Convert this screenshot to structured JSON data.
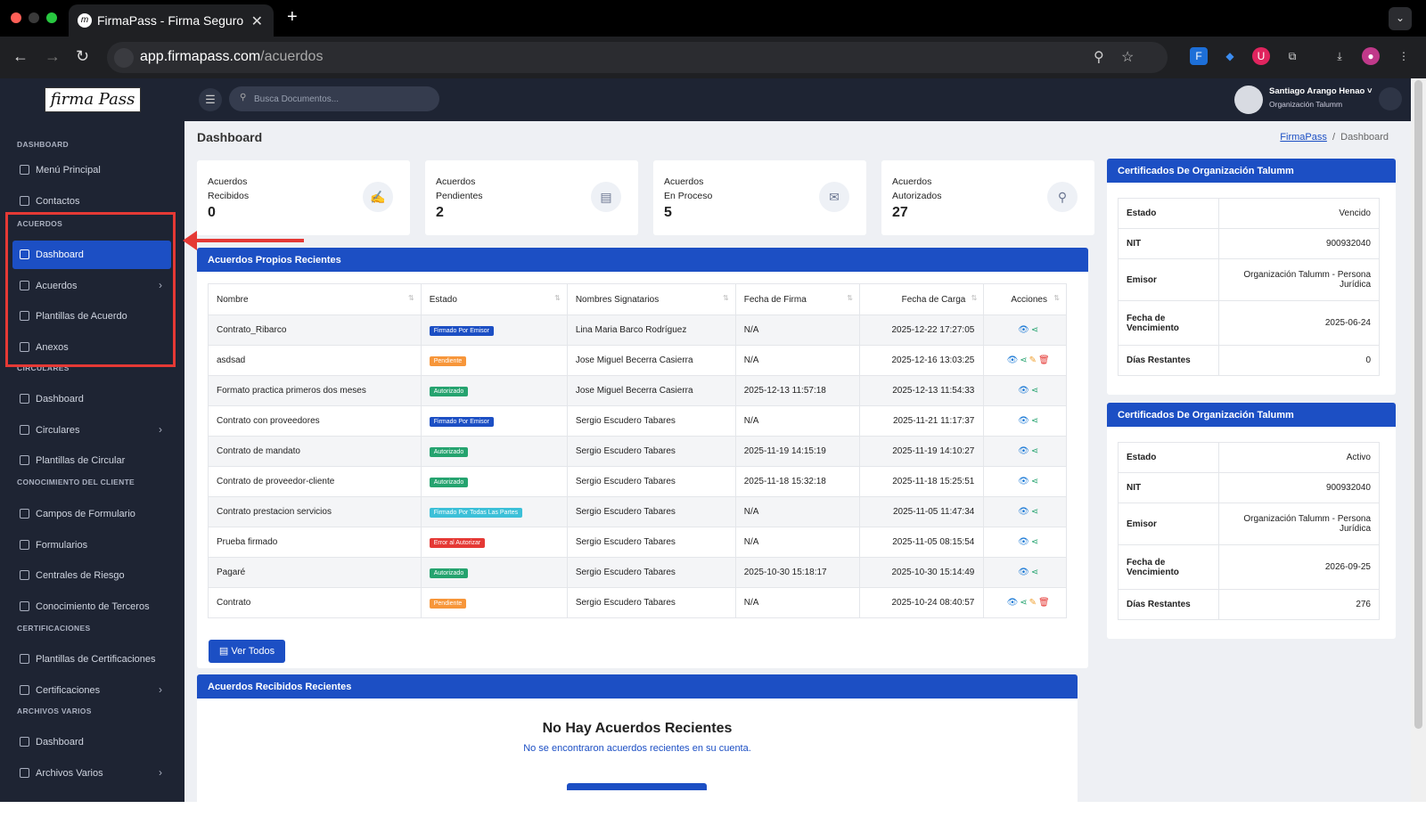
{
  "browser": {
    "tab_title": "FirmaPass - Firma Seguro",
    "url_host": "app.firmapass.com",
    "url_path": "/acuerdos"
  },
  "app": {
    "logo": "firma Pass",
    "search_placeholder": "Busca Documentos...",
    "user_name": "Santiago Arango Henao",
    "user_org": "Organización Talumm"
  },
  "sidebar": {
    "sections": [
      "DASHBOARD",
      "ACUERDOS",
      "CIRCULARES",
      "CONOCIMIENTO DEL CLIENTE",
      "CERTIFICACIONES",
      "ARCHIVOS VARIOS"
    ],
    "items": [
      "Menú Principal",
      "Contactos",
      "Dashboard",
      "Acuerdos",
      "Plantillas de Acuerdo",
      "Anexos",
      "Dashboard",
      "Circulares",
      "Plantillas de Circular",
      "Campos de Formulario",
      "Formularios",
      "Centrales de Riesgo",
      "Conocimiento de Terceros",
      "Plantillas de Certificaciones",
      "Certificaciones",
      "Dashboard",
      "Archivos Varios"
    ]
  },
  "page": {
    "title": "Dashboard",
    "breadcrumb_home": "FirmaPass",
    "breadcrumb_sep": "/",
    "breadcrumb_current": "Dashboard"
  },
  "stats": [
    {
      "l1": "Acuerdos",
      "l2": "Recibidos",
      "value": "0"
    },
    {
      "l1": "Acuerdos",
      "l2": "Pendientes",
      "value": "2"
    },
    {
      "l1": "Acuerdos",
      "l2": "En Proceso",
      "value": "5"
    },
    {
      "l1": "Acuerdos",
      "l2": "Autorizados",
      "value": "27"
    }
  ],
  "recent": {
    "title": "Acuerdos Propios Recientes",
    "columns": [
      "Nombre",
      "Estado",
      "Nombres Signatarios",
      "Fecha de Firma",
      "Fecha de Carga",
      "Acciones"
    ],
    "rows": [
      [
        "Contrato_Ribarco",
        "Firmado Por Emisor",
        "Lina Maria Barco Rodríguez",
        "N/A",
        "2025-12-22 17:27:05"
      ],
      [
        "asdsad",
        "Pendiente",
        "Jose Miguel Becerra Casierra",
        "N/A",
        "2025-12-16 13:03:25"
      ],
      [
        "Formato practica primeros dos meses",
        "Autorizado",
        "Jose Miguel Becerra Casierra",
        "2025-12-13 11:57:18",
        "2025-12-13 11:54:33"
      ],
      [
        "Contrato con proveedores",
        "Firmado Por Emisor",
        "Sergio Escudero Tabares",
        "N/A",
        "2025-11-21 11:17:37"
      ],
      [
        "Contrato de mandato",
        "Autorizado",
        "Sergio Escudero Tabares",
        "2025-11-19 14:15:19",
        "2025-11-19 14:10:27"
      ],
      [
        "Contrato de proveedor-cliente",
        "Autorizado",
        "Sergio Escudero Tabares",
        "2025-11-18 15:32:18",
        "2025-11-18 15:25:51"
      ],
      [
        "Contrato prestacion servicios",
        "Firmado Por Todas Las Partes",
        "Sergio Escudero Tabares",
        "N/A",
        "2025-11-05 11:47:34"
      ],
      [
        "Prueba firmado",
        "Error al Autorizar",
        "Sergio Escudero Tabares",
        "N/A",
        "2025-11-05 08:15:54"
      ],
      [
        "Pagaré",
        "Autorizado",
        "Sergio Escudero Tabares",
        "2025-10-30 15:18:17",
        "2025-10-30 15:14:49"
      ],
      [
        "Contrato",
        "Pendiente",
        "Sergio Escudero Tabares",
        "N/A",
        "2025-10-24 08:40:57"
      ]
    ],
    "badge_colors": {
      "Firmado Por Emisor": "#1c4fc4",
      "Pendiente": "#f7963a",
      "Autorizado": "#25a36f",
      "Firmado Por Todas Las Partes": "#3cc0d8",
      "Error al Autorizar": "#e53935"
    },
    "button": "Ver Todos"
  },
  "certs": [
    {
      "title": "Certificados De Organización Talumm",
      "rows": [
        [
          "Estado",
          "Vencido"
        ],
        [
          "NIT",
          "900932040"
        ],
        [
          "Emisor",
          "Organización Talumm - Persona Jurídica"
        ],
        [
          "Fecha de Vencimiento",
          "2025-06-24"
        ],
        [
          "Días Restantes",
          "0"
        ]
      ]
    },
    {
      "title": "Certificados De Organización Talumm",
      "rows": [
        [
          "Estado",
          "Activo"
        ],
        [
          "NIT",
          "900932040"
        ],
        [
          "Emisor",
          "Organización Talumm - Persona Jurídica"
        ],
        [
          "Fecha de Vencimiento",
          "2026-09-25"
        ],
        [
          "Días Restantes",
          "276"
        ]
      ]
    }
  ],
  "received": {
    "title": "Acuerdos Recibidos Recientes",
    "empty_title": "No Hay Acuerdos Recientes",
    "empty_text": "No se encontraron acuerdos recientes en su cuenta."
  }
}
